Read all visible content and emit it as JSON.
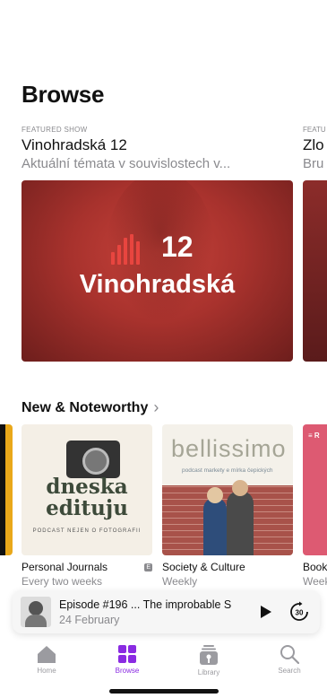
{
  "page": {
    "title": "Browse"
  },
  "featured": {
    "kicker": "FEATURED SHOW",
    "title": "Vinohradská 12",
    "subtitle": "Aktuální témata v souvislostech v...",
    "art_number": "12",
    "art_brand": "Vinohradská",
    "accent": "#a8322d"
  },
  "featured_peek": {
    "kicker": "FEATU",
    "title": "Zlo",
    "subtitle": "Bru"
  },
  "new_noteworthy": {
    "heading": "New & Noteworthy",
    "items": [
      {
        "cover_title_1": "dneska",
        "cover_title_2": "edituju",
        "cover_tiny": "PODCAST NEJEN O FOTOGRAFII",
        "category": "Personal Journals",
        "explicit": "E",
        "frequency": "Every two weeks"
      },
      {
        "cover_logo": "bellissimo",
        "cover_tag": "podcast markety e mírka čepických",
        "category": "Society & Culture",
        "frequency": "Weekly"
      }
    ],
    "peek": {
      "cover_label": "≡ R",
      "category": "Book",
      "frequency": "Week"
    }
  },
  "mini_player": {
    "episode": "Episode #196 ... The improbable S",
    "date": "24 February",
    "play_icon": "play-icon",
    "skip_icon": "skip-forward-30-icon",
    "skip_label": "30"
  },
  "tabbar": {
    "tabs": [
      {
        "label": "Home",
        "icon": "home-icon"
      },
      {
        "label": "Browse",
        "icon": "browse-icon",
        "active": true
      },
      {
        "label": "Library",
        "icon": "library-icon"
      },
      {
        "label": "Search",
        "icon": "search-icon"
      }
    ],
    "active_color": "#8a2be2",
    "inactive_color": "#9b9ba0"
  }
}
